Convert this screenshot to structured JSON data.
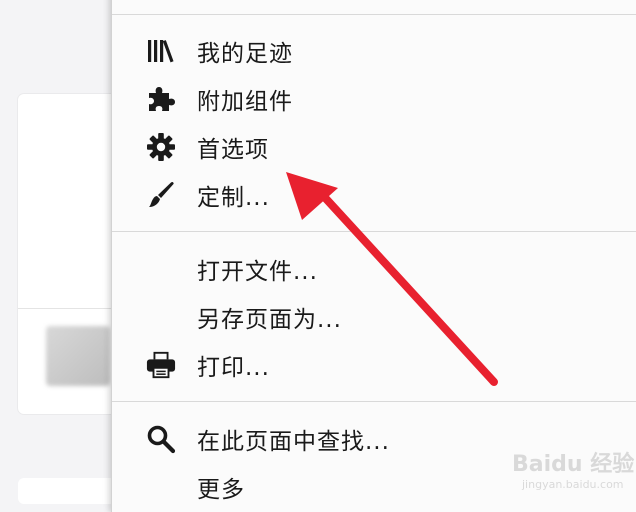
{
  "menu": {
    "items": [
      {
        "label": "我的足迹",
        "icon": "library-icon"
      },
      {
        "label": "附加组件",
        "icon": "puzzle-piece-icon"
      },
      {
        "label": "首选项",
        "icon": "gear-icon"
      },
      {
        "label": "定制...",
        "icon": "paintbrush-icon"
      },
      {
        "label": "打开文件...",
        "icon": ""
      },
      {
        "label": "另存页面为...",
        "icon": ""
      },
      {
        "label": "打印...",
        "icon": "printer-icon"
      },
      {
        "label": "在此页面中查找...",
        "icon": "search-icon"
      },
      {
        "label": "更多",
        "icon": ""
      }
    ]
  },
  "annotation": {
    "arrow_color": "#e8212f"
  },
  "watermark": {
    "text": "Baidu 经验",
    "sub": "jingyan.baidu.com"
  }
}
